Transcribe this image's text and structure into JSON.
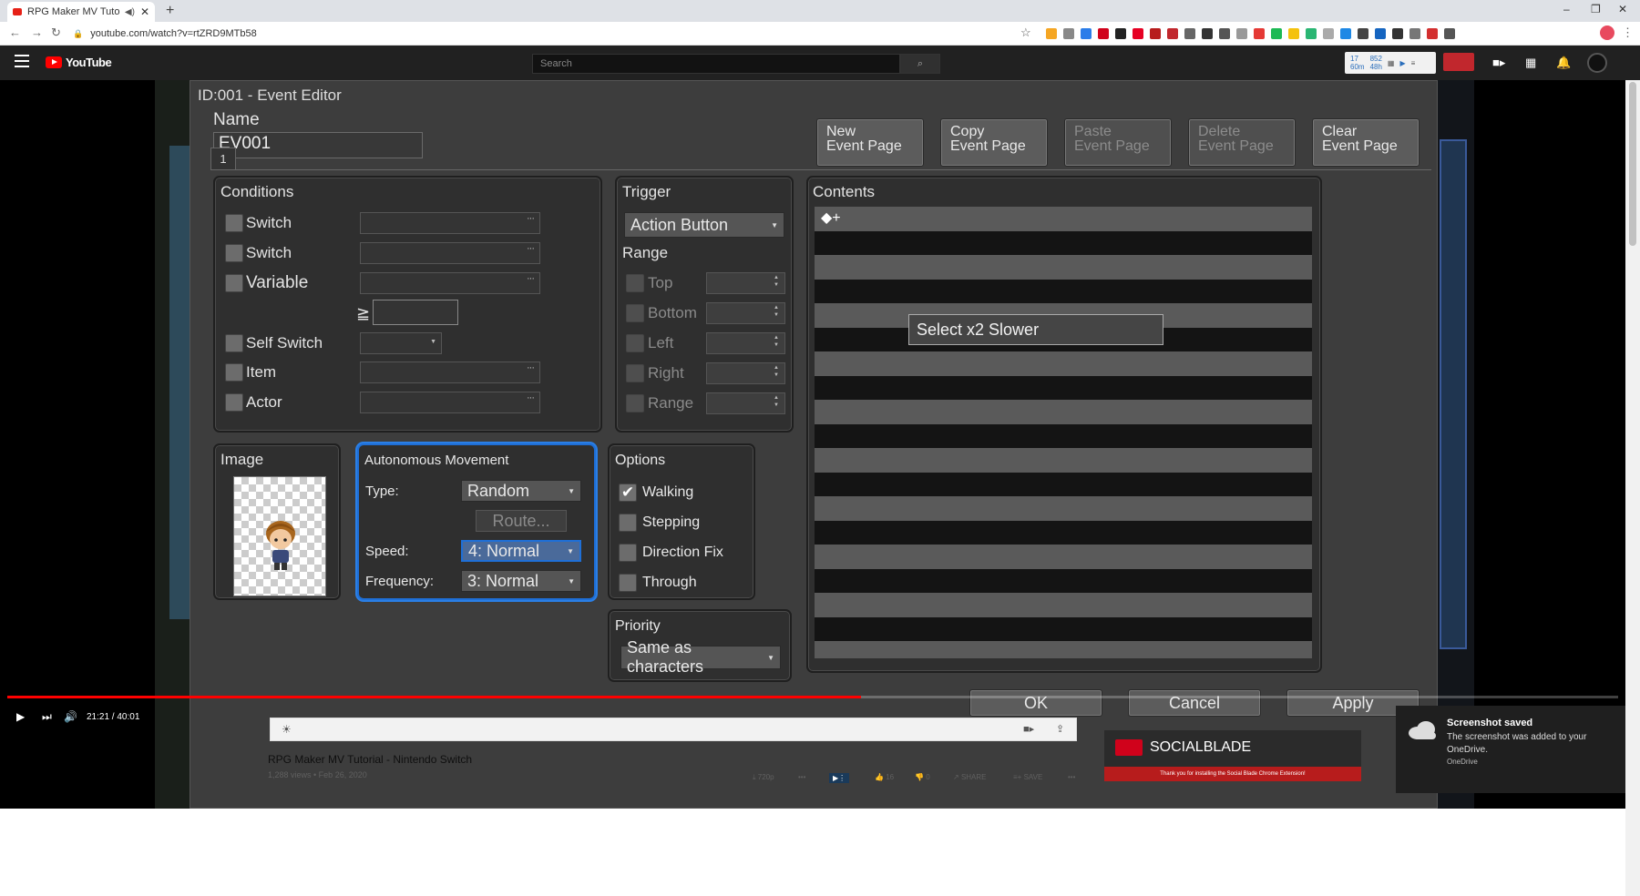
{
  "browser": {
    "tab_title": "RPG Maker MV Tutorial - Ni",
    "tab_audio": "◀)",
    "url": "youtube.com/watch?v=rtZRD9MTb58"
  },
  "youtube": {
    "logo_text": "YouTube",
    "search_placeholder": "Search",
    "socialblade_widget": {
      "subs_top": "17",
      "subs_sub": "60m",
      "views_top": "852",
      "views_sub": "48h"
    }
  },
  "editor": {
    "title": "ID:001 - Event Editor",
    "name_label": "Name",
    "name_value": "EV001",
    "page_buttons": [
      {
        "l1": "New",
        "l2": "Event Page",
        "enabled": true
      },
      {
        "l1": "Copy",
        "l2": "Event Page",
        "enabled": true
      },
      {
        "l1": "Paste",
        "l2": "Event Page",
        "enabled": false
      },
      {
        "l1": "Delete",
        "l2": "Event Page",
        "enabled": false
      },
      {
        "l1": "Clear",
        "l2": "Event Page",
        "enabled": true
      }
    ],
    "page_tab": "1",
    "conditions": {
      "title": "Conditions",
      "switch1": "Switch",
      "switch2": "Switch",
      "variable": "Variable",
      "gte": "≧",
      "self_switch": "Self Switch",
      "item": "Item",
      "actor": "Actor",
      "dots": "···"
    },
    "trigger": {
      "title": "Trigger",
      "value": "Action Button",
      "range_title": "Range",
      "top": "Top",
      "bottom": "Bottom",
      "left": "Left",
      "right": "Right",
      "range": "Range"
    },
    "contents": {
      "title": "Contents",
      "first_row": "◆+",
      "tooltip": "Select x2 Slower"
    },
    "image": {
      "title": "Image"
    },
    "autonomous": {
      "title": "Autonomous Movement",
      "type_label": "Type:",
      "type_value": "Random",
      "route_button": "Route...",
      "speed_label": "Speed:",
      "speed_value": "4: Normal",
      "frequency_label": "Frequency:",
      "frequency_value": "3: Normal"
    },
    "options": {
      "title": "Options",
      "walking": "Walking",
      "walking_checked": true,
      "stepping": "Stepping",
      "direction_fix": "Direction Fix",
      "through": "Through"
    },
    "priority": {
      "title": "Priority",
      "value": "Same as characters"
    },
    "footer": {
      "ok": "OK",
      "cancel": "Cancel",
      "apply": "Apply"
    }
  },
  "player": {
    "time": "21:21 / 40:01",
    "progress_fraction": 0.53
  },
  "video_info": {
    "title": "RPG Maker MV Tutorial - Nintendo Switch",
    "meta": "1,288 views • Feb 26, 2020",
    "quality": "720p",
    "likes": "16",
    "dislikes": "0",
    "share": "SHARE",
    "save": "SAVE"
  },
  "socialblade": {
    "brand": "SOCIALBLADE",
    "strip": "Thank you for installing the Social Blade Chrome Extension!"
  },
  "toast": {
    "title": "Screenshot saved",
    "body": "The screenshot was added to your OneDrive.",
    "source": "OneDrive"
  },
  "colors": {
    "youtube_red": "#ff0000",
    "selection_blue": "#1f6fd6",
    "dialog_bg": "#3d3d3d"
  }
}
